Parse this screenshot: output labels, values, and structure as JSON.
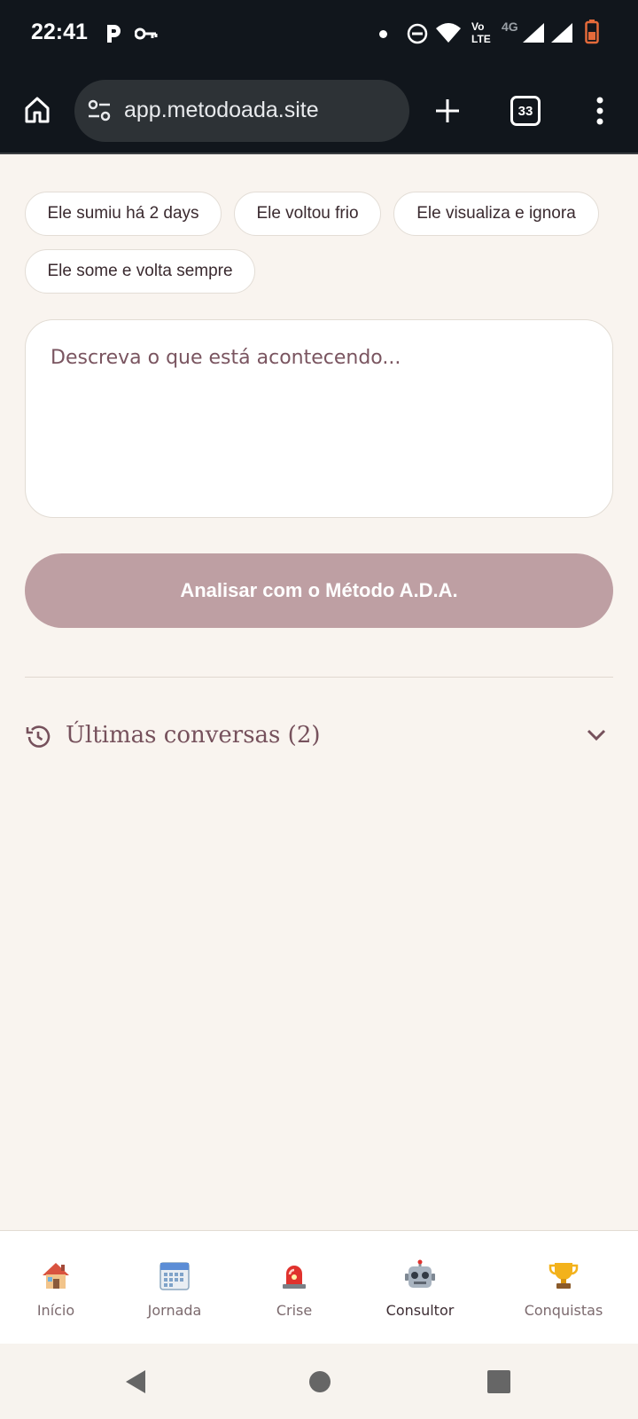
{
  "status_bar": {
    "time": "22:41",
    "network_top": "Vo",
    "network_bottom": "LTE",
    "network_type": "4G"
  },
  "browser": {
    "url": "app.metodoada.site",
    "tab_count": "33"
  },
  "chips": [
    {
      "label": "Ele sumiu há 2 days"
    },
    {
      "label": "Ele voltou frio"
    },
    {
      "label": "Ele visualiza e ignora"
    },
    {
      "label": "Ele some e volta sempre"
    }
  ],
  "input": {
    "placeholder": "Descreva o que está acontecendo...",
    "value": ""
  },
  "analyze_button": {
    "label": "Analisar com o Método A.D.A."
  },
  "history": {
    "title": "Últimas conversas (2)"
  },
  "bottom_nav": {
    "items": [
      {
        "label": "Início",
        "icon": "house-icon"
      },
      {
        "label": "Jornada",
        "icon": "calendar-icon"
      },
      {
        "label": "Crise",
        "icon": "siren-icon"
      },
      {
        "label": "Consultor",
        "icon": "robot-icon"
      },
      {
        "label": "Conquistas",
        "icon": "trophy-icon"
      }
    ],
    "active": "Consultor"
  },
  "colors": {
    "page_background": "#f9f4ef",
    "accent": "#be9fa3",
    "text_primary": "#76515c",
    "browser_chrome": "#11161c"
  }
}
